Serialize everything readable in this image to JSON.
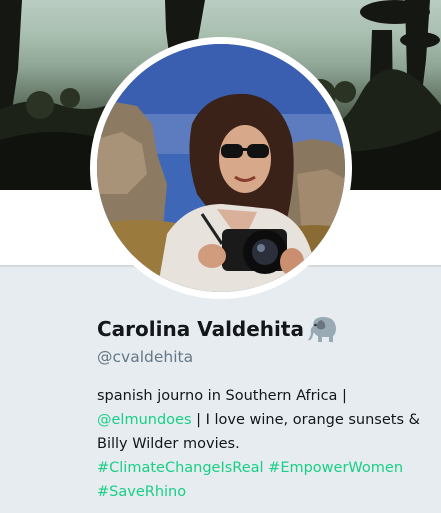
{
  "profile": {
    "display_name": "Carolina Valdehita",
    "name_emoji": "elephant-icon",
    "handle": "@cvaldehita",
    "bio": {
      "text_1": "spanish journo in Southern Africa |",
      "mention": "@elmundoes",
      "text_2": " | I love wine, orange sunsets & Billy Wilder movies.",
      "hashtag_1": "#ClimateChangeIsReal",
      "hashtag_2": "#EmpowerWomen",
      "hashtag_3": "#SaveRhino"
    }
  },
  "colors": {
    "link": "#19cf86",
    "name": "#14171a",
    "handle": "#657786",
    "background": "#e6ecf0"
  }
}
